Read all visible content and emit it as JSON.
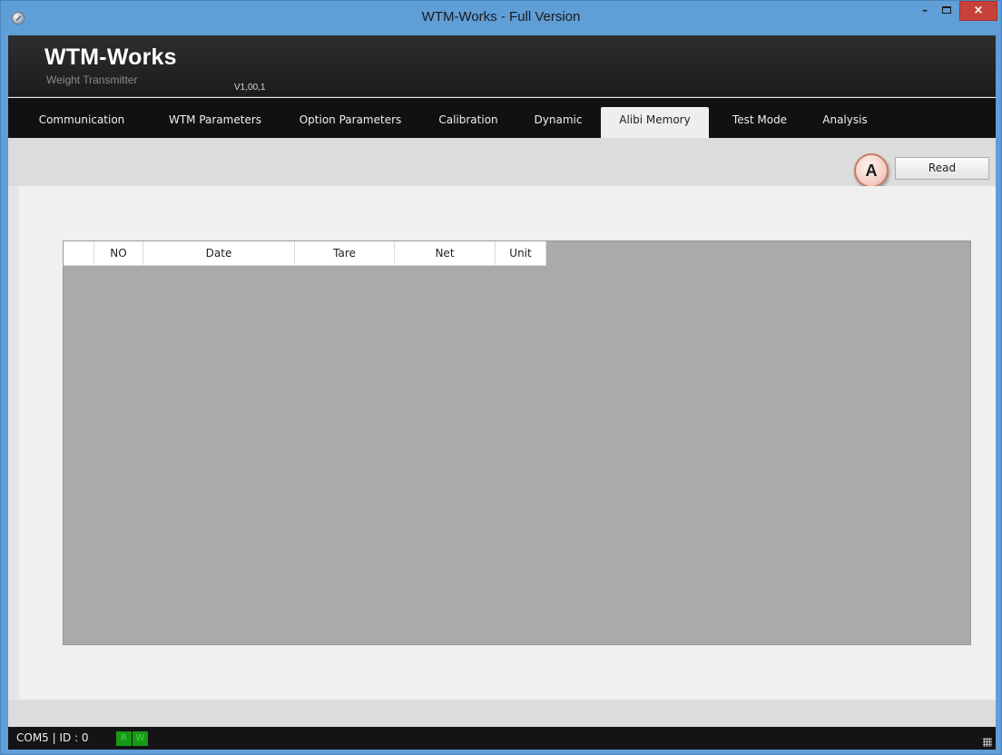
{
  "window": {
    "title": "WTM-Works - Full Version",
    "minimize_glyph": "–",
    "close_glyph": "×",
    "icon": "app-disc-icon"
  },
  "brand": {
    "title": "WTM-Works",
    "subtitle": "Weight Transmitter",
    "version": "V1,00,1"
  },
  "tabs": [
    {
      "label": "Communication"
    },
    {
      "label": "WTM Parameters"
    },
    {
      "label": "Option Parameters"
    },
    {
      "label": "Calibration"
    },
    {
      "label": "Dynamic"
    },
    {
      "label": "Alibi Memory",
      "active": true
    },
    {
      "label": "Test Mode"
    },
    {
      "label": "Analysis"
    }
  ],
  "toolbar": {
    "read_label": "Read",
    "marker_label": "A"
  },
  "grid": {
    "columns": [
      "",
      "NO",
      "Date",
      "Tare",
      "Net",
      "Unit"
    ],
    "rows": []
  },
  "status": {
    "connection": "COM5 | ID : 0",
    "rx_label": "R",
    "tx_label": "W"
  },
  "colors": {
    "titlebar": "#5f9ed6",
    "close_button": "#c7413a",
    "tabbar": "#111111",
    "active_tab": "#eeeeee",
    "grid_background": "#aaaaaa",
    "led_green": "#169a16"
  }
}
